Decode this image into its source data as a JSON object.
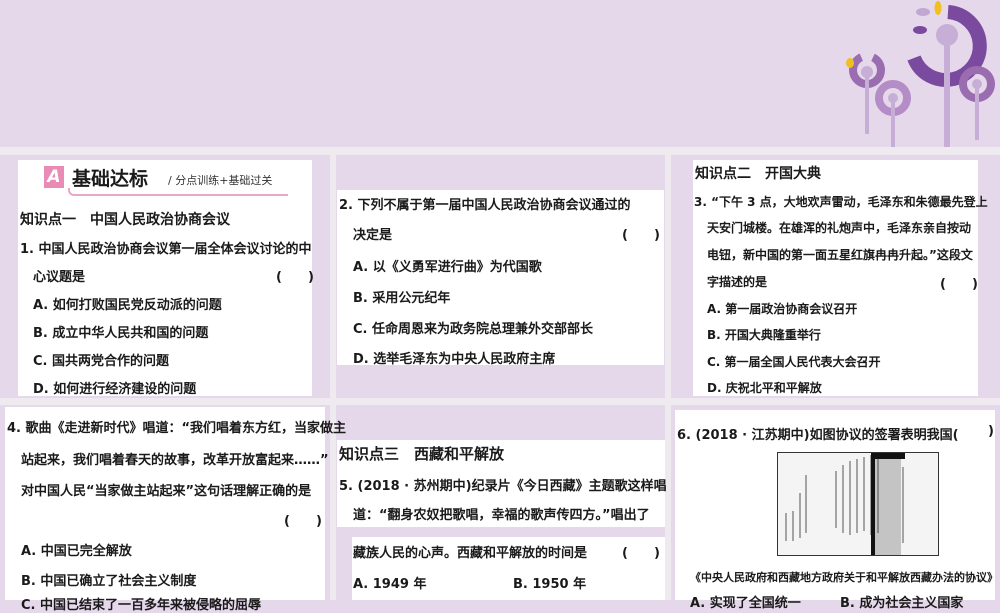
{
  "header_section": {
    "badge": "A",
    "title": "基础达标",
    "subtitle": "/ 分点训练+基础过关"
  },
  "kp1": {
    "heading": "知识点一　中国人民政治协商会议",
    "q1": {
      "lines": [
        "1. 中国人民政治协商会议第一届全体会议讨论的中",
        "心议题是"
      ],
      "paren": "(　　)",
      "options": [
        "A. 如何打败国民党反动派的问题",
        "B. 成立中华人民共和国的问题",
        "C. 国共两党合作的问题",
        "D. 如何进行经济建设的问题"
      ]
    },
    "q2": {
      "lines": [
        "2. 下列不属于第一届中国人民政治协商会议通过的",
        "决定是"
      ],
      "paren": "(　　)",
      "options": [
        "A. 以《义勇军进行曲》为代国歌",
        "B. 采用公元纪年",
        "C. 任命周恩来为政务院总理兼外交部部长",
        "D. 选举毛泽东为中央人民政府主席"
      ]
    }
  },
  "kp2": {
    "heading": "知识点二　开国大典",
    "q3": {
      "lines": [
        "3. “下午 3 点，大地欢声雷动，毛泽东和朱德最先登上",
        "天安门城楼。在雄浑的礼炮声中，毛泽东亲自按动",
        "电钮，新中国的第一面五星红旗冉冉升起。”这段文",
        "字描述的是"
      ],
      "paren": "(　　)",
      "options": [
        "A. 第一届政治协商会议召开",
        "B. 开国大典隆重举行",
        "C. 第一届全国人民代表大会召开",
        "D. 庆祝北平和平解放"
      ]
    },
    "q4": {
      "lines": [
        "4. 歌曲《走进新时代》唱道：“我们唱着东方红，当家做主",
        "站起来，我们唱着春天的故事，改革开放富起来……”",
        "对中国人民“当家做主站起来”这句话理解正确的是"
      ],
      "paren": "(　　)",
      "options": [
        "A. 中国已完全解放",
        "B. 中国已确立了社会主义制度",
        "C. 中国已结束了一百多年来被侵略的屈辱"
      ]
    }
  },
  "kp3": {
    "heading": "知识点三　西藏和平解放",
    "q5": {
      "lines": [
        "5. (2018 · 苏州期中)纪录片《今日西藏》主题歌这样唱",
        "道：“翻身农奴把歌唱，幸福的歌声传四方。”唱出了",
        "藏族人民的心声。西藏和平解放的时间是"
      ],
      "paren": "(　　)",
      "options": [
        "A. 1949 年",
        "B. 1950 年"
      ]
    },
    "q6": {
      "line": "6. (2018 · 江苏期中)如图协议的签署表明我国(",
      "paren_close": ")",
      "caption": "《中央人民政府和西藏地方政府关于和平解放西藏办法的协议》",
      "options": [
        "A. 实现了全国统一",
        "B. 成为社会主义国家"
      ]
    }
  },
  "colors": {
    "background": "#e6d8eb",
    "accent_purple": "#7a4a9e",
    "pink": "#e88bb5",
    "yellow": "#f0c020"
  }
}
